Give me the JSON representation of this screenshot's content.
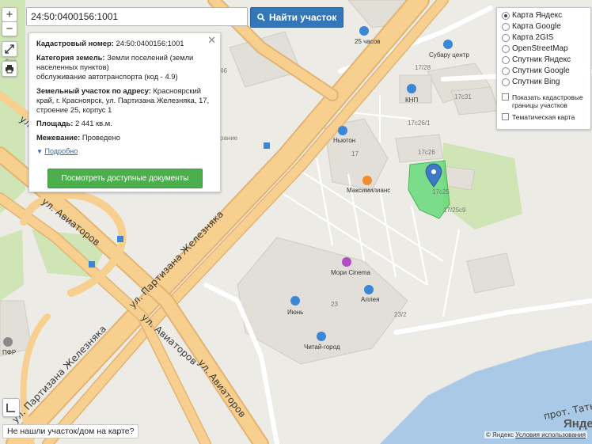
{
  "search": {
    "value": "24:50:0400156:1001",
    "button_label": "Найти участок"
  },
  "zoom": {
    "in": "+",
    "out": "−"
  },
  "info": {
    "cad_label": "Кадастровый номер:",
    "cad_value": "24:50:0400156:1001",
    "category_label": "Категория земель:",
    "category_value": "Земли поселений (земли населенных пунктов)",
    "use_value": "обслуживание автотранспорта (код - 4.9)",
    "address_label": "Земельный участок по адресу:",
    "address_value": "Красноярский край, г. Красноярск, ул. Партизана Железняка, 17, строение 25, корпус 1",
    "area_label": "Площадь:",
    "area_value": "2 441 кв.м.",
    "survey_label": "Межевание:",
    "survey_value": "Проведено",
    "more_label": "Подробно",
    "docs_button": "Посмотреть доступные документы"
  },
  "layers": {
    "items": [
      "Карта Яндекс",
      "Карта Google",
      "Карта 2GIS",
      "OpenStreetMap",
      "Спутник Яндекс",
      "Спутник Google",
      "Спутник Bing"
    ],
    "selected": "Карта Яндекс",
    "show_cadastral": "Показать кадастровые границы участков",
    "thematic": "Тематическая карта"
  },
  "not_found": "Не нашли участок/дом на карте?",
  "copyright": {
    "symbol": "© Яндекс",
    "terms": "Условия использования"
  },
  "logo": "Яндекс",
  "map": {
    "streets": [
      "ул. Партизана Железняка",
      "ул. Партизана Железняка",
      "ул. Авиаторов",
      "ул. Авиаторов",
      "ул. Авиаторов",
      "ул. Авиаторов",
      "прот. Татышева"
    ],
    "pois": [
      "Мори Cinema",
      "Аллея",
      "Июнь",
      "Читай-город",
      "Ньютон",
      "Максимилианс",
      "25 часов",
      "Субару центр",
      "КНП",
      "ПФР"
    ],
    "house_numbers": [
      "17",
      "23",
      "23/2",
      "17с26/1",
      "17с26",
      "17с25",
      "17/25с9",
      "17с31",
      "17/28"
    ],
    "partial_labels": [
      "Фор",
      "46",
      "рание"
    ],
    "marker_color": "#3d79c4",
    "parcel_color": "#56d86b"
  }
}
